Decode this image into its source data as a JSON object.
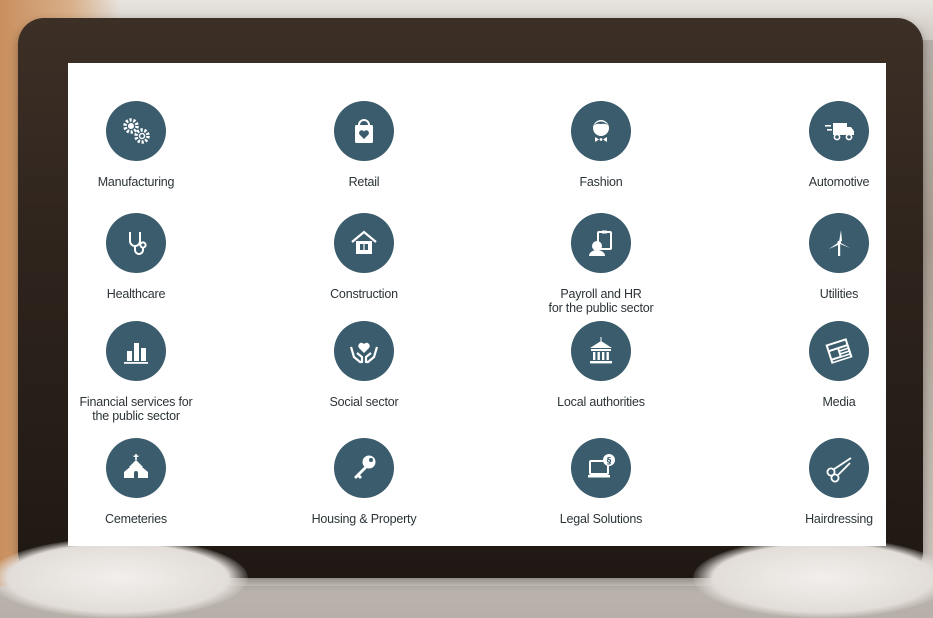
{
  "colors": {
    "icon_bg": "#3a5c6c",
    "icon_fg": "#ffffff",
    "label": "#2c3438"
  },
  "sectors": [
    {
      "label": "Manufacturing",
      "icon": "gears-icon"
    },
    {
      "label": "Retail",
      "icon": "shopping-bag-heart-icon"
    },
    {
      "label": "Fashion",
      "icon": "person-bowtie-icon"
    },
    {
      "label": "Automotive",
      "icon": "delivery-truck-icon"
    },
    {
      "label": "Healthcare",
      "icon": "stethoscope-icon"
    },
    {
      "label": "Construction",
      "icon": "house-icon"
    },
    {
      "label": "Payroll and HR",
      "label2": "for the public sector",
      "icon": "clipboard-person-icon"
    },
    {
      "label": "Utilities",
      "icon": "wind-turbine-icon"
    },
    {
      "label": "Financial services for",
      "label2": "the public sector",
      "icon": "bar-chart-icon"
    },
    {
      "label": "Social sector",
      "icon": "hands-heart-icon"
    },
    {
      "label": "Local authorities",
      "icon": "government-building-icon"
    },
    {
      "label": "Media",
      "icon": "newspaper-icon"
    },
    {
      "label": "Cemeteries",
      "icon": "chapel-icon"
    },
    {
      "label": "Housing & Property",
      "icon": "key-icon"
    },
    {
      "label": "Legal Solutions",
      "icon": "computer-paragraph-icon"
    },
    {
      "label": "Hairdressing",
      "icon": "scissors-icon"
    }
  ]
}
